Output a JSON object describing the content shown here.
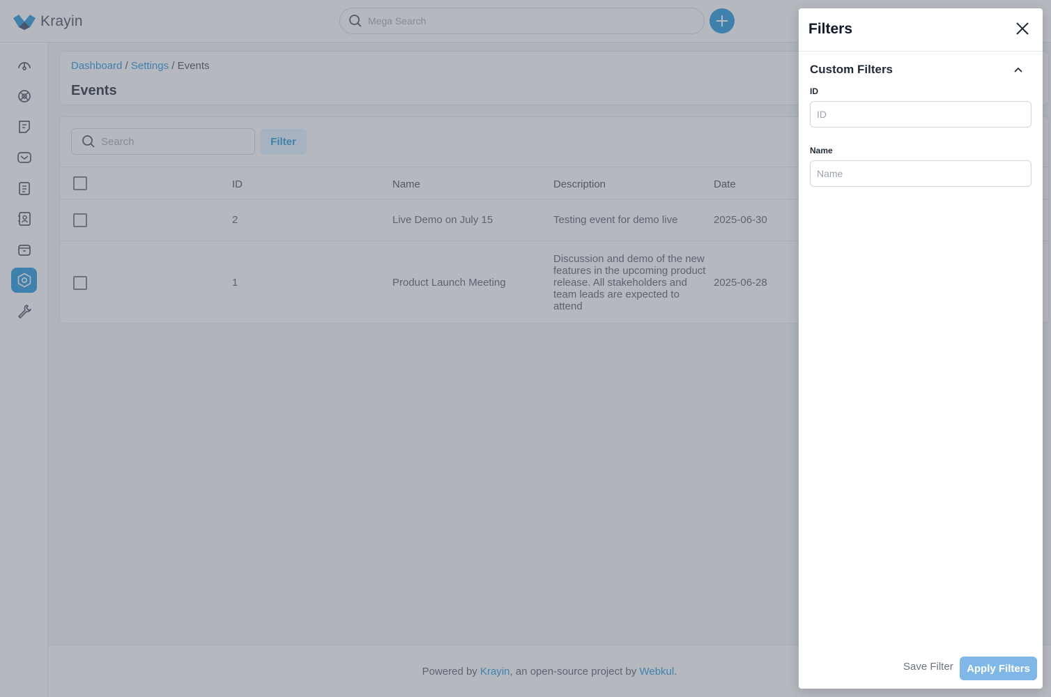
{
  "app": {
    "name": "Krayin"
  },
  "header": {
    "search_placeholder": "Mega Search"
  },
  "sidebar": {
    "items": [
      {
        "name": "dashboard"
      },
      {
        "name": "leads"
      },
      {
        "name": "quotes"
      },
      {
        "name": "mail"
      },
      {
        "name": "activities"
      },
      {
        "name": "contacts"
      },
      {
        "name": "products"
      },
      {
        "name": "settings",
        "active": true
      },
      {
        "name": "configuration"
      }
    ]
  },
  "breadcrumb": {
    "dashboard": "Dashboard",
    "sep1": " / ",
    "settings": "Settings",
    "sep2": " / ",
    "current": "Events"
  },
  "page": {
    "title": "Events"
  },
  "grid": {
    "search_placeholder": "Search",
    "filter_label": "Filter",
    "columns": [
      "ID",
      "Name",
      "Description",
      "Date"
    ],
    "rows": [
      {
        "id": "2",
        "name": "Live Demo on July 15",
        "description": "Testing event for demo live",
        "date": "2025-06-30"
      },
      {
        "id": "1",
        "name": "Product Launch Meeting",
        "description": "Discussion and demo of the new features in the upcoming product release. All stakeholders and team leads are expected to attend",
        "date": "2025-06-28"
      }
    ]
  },
  "footer": {
    "prefix": "Powered by ",
    "krayin": "Krayin",
    "middle": ", an open-source project by ",
    "webkul": "Webkul",
    "suffix": "."
  },
  "drawer": {
    "title": "Filters",
    "section_title": "Custom Filters",
    "fields": [
      {
        "label": "ID",
        "placeholder": "ID"
      },
      {
        "label": "Name",
        "placeholder": "Name"
      }
    ],
    "save_label": "Save Filter",
    "apply_label": "Apply Filters"
  },
  "colors": {
    "accent": "#0E90D9",
    "overlay": "#6b7280"
  }
}
